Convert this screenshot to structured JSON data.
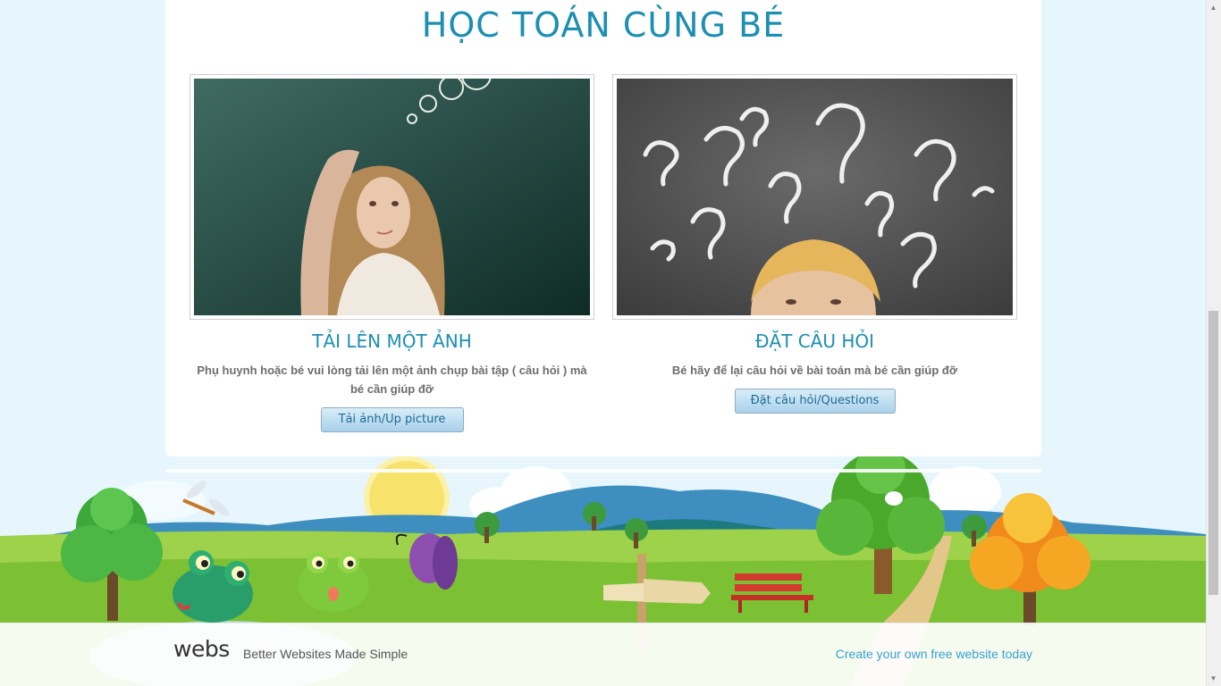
{
  "page": {
    "title": "HỌC TOÁN CÙNG BÉ"
  },
  "columns": [
    {
      "heading": "TẢI LÊN MỘT ẢNH",
      "description": "Phụ huynh hoặc bé vui lòng tải lên một ảnh chụp bài tập ( câu hỏi ) mà bé cần giúp đỡ",
      "button_label": "Tải ảnh/Up picture",
      "image": "thinking-girl-photo"
    },
    {
      "heading": "ĐẶT CÂU HỎI",
      "description": "Bé hãy để lại câu hỏi về bài toán mà bé cần giúp đỡ",
      "button_label": "Đặt câu hỏi/Questions",
      "image": "question-marks-boy-photo"
    }
  ],
  "footer": {
    "logo": "webs",
    "tagline": "Better Websites Made Simple",
    "cta_link": "Create your own free website today"
  },
  "colors": {
    "accent": "#1c8fb2",
    "background": "#e7f6fd",
    "link": "#3a9fd0"
  }
}
